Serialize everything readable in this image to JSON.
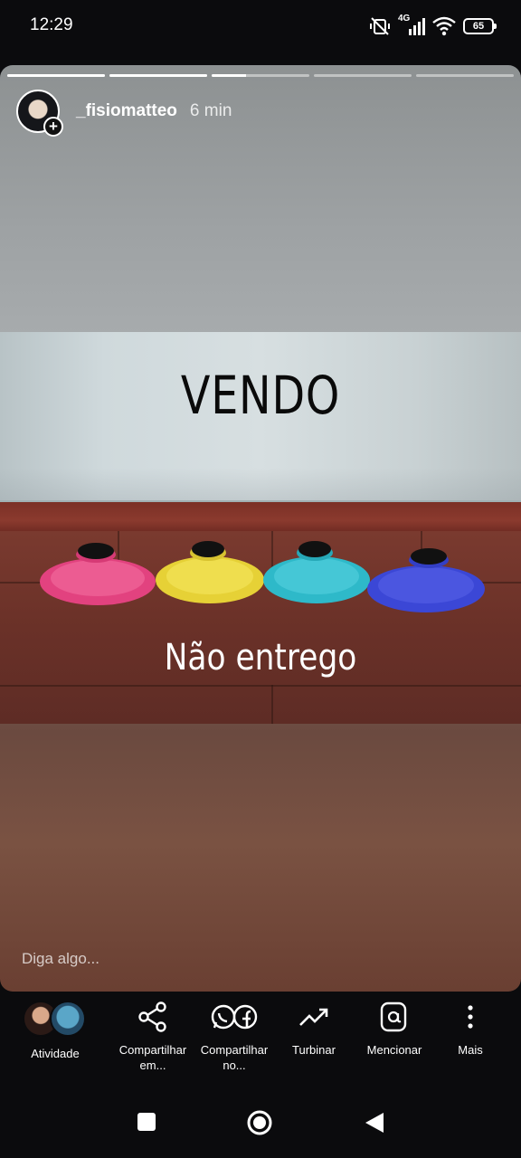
{
  "status_bar": {
    "time": "12:29",
    "network": "4G",
    "battery": "65",
    "icons": [
      "mute-vibrate-icon",
      "signal-icon",
      "wifi-icon",
      "battery-icon"
    ]
  },
  "story": {
    "segments_total": 5,
    "segments_complete": 2,
    "current_segment_progress": 0.35,
    "username": "_fisiomatteo",
    "time_ago": "6 min",
    "text_top": "VENDO",
    "text_bottom": "Não entrego",
    "reply_placeholder": "Diga algo..."
  },
  "actions": {
    "activity_label": "Atividade",
    "share_label_1": "Compartilhar",
    "share_label_2": "em...",
    "share_no_label_1": "Compartilhar",
    "share_no_label_2": "no...",
    "boost_label": "Turbinar",
    "mention_label": "Mencionar",
    "more_label": "Mais"
  },
  "colors": {
    "cone_pink": "#e2427f",
    "cone_yellow": "#e6d136",
    "cone_teal": "#2eb9c9",
    "cone_blue": "#3b47d6"
  }
}
